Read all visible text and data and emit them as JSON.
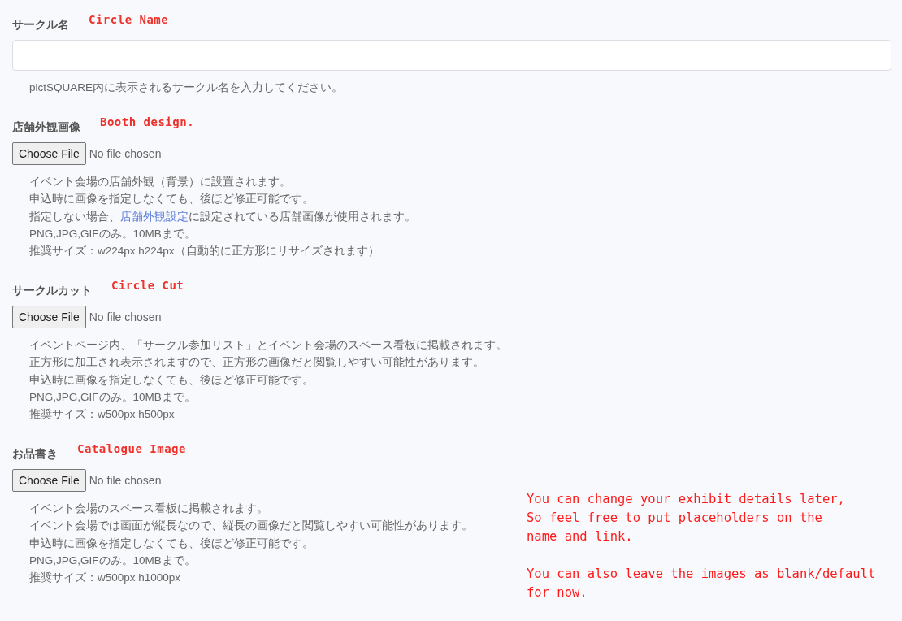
{
  "sections": [
    {
      "kind": "text",
      "label": "サークル名",
      "annotation": "Circle Name",
      "help": [
        "pictSQUARE内に表示されるサークル名を入力してください。"
      ]
    },
    {
      "kind": "file",
      "label": "店舗外観画像",
      "annotation": "Booth design.",
      "button": "Choose File",
      "status": "No file chosen",
      "help": [
        "イベント会場の店舗外観（背景）に設置されます。",
        "申込時に画像を指定しなくても、後ほど修正可能です。",
        {
          "before": "指定しない場合、",
          "link": "店舗外観設定",
          "after": "に設定されている店舗画像が使用されます。"
        },
        "PNG,JPG,GIFのみ。10MBまで。",
        "推奨サイズ：w224px h224px（自動的に正方形にリサイズされます）"
      ]
    },
    {
      "kind": "file",
      "label": "サークルカット",
      "annotation": "Circle Cut",
      "button": "Choose File",
      "status": "No file chosen",
      "help": [
        "イベントページ内、「サークル参加リスト」とイベント会場のスペース看板に掲載されます。",
        "正方形に加工され表示されますので、正方形の画像だと閲覧しやすい可能性があります。",
        "申込時に画像を指定しなくても、後ほど修正可能です。",
        "PNG,JPG,GIFのみ。10MBまで。",
        "推奨サイズ：w500px h500px"
      ]
    },
    {
      "kind": "file",
      "label": "お品書き",
      "annotation": "Catalogue Image",
      "button": "Choose File",
      "status": "No file chosen",
      "help": [
        "イベント会場のスペース看板に掲載されます。",
        "イベント会場では画面が縦長なので、縦長の画像だと閲覧しやすい可能性があります。",
        "申込時に画像を指定しなくても、後ほど修正可能です。",
        "PNG,JPG,GIFのみ。10MBまで。",
        "推奨サイズ：w500px h1000px"
      ]
    }
  ],
  "note": [
    "You can change your exhibit details later,\nSo feel free to put placeholders on the\nname and link.",
    "You can also leave the images as blank/default\nfor now."
  ]
}
